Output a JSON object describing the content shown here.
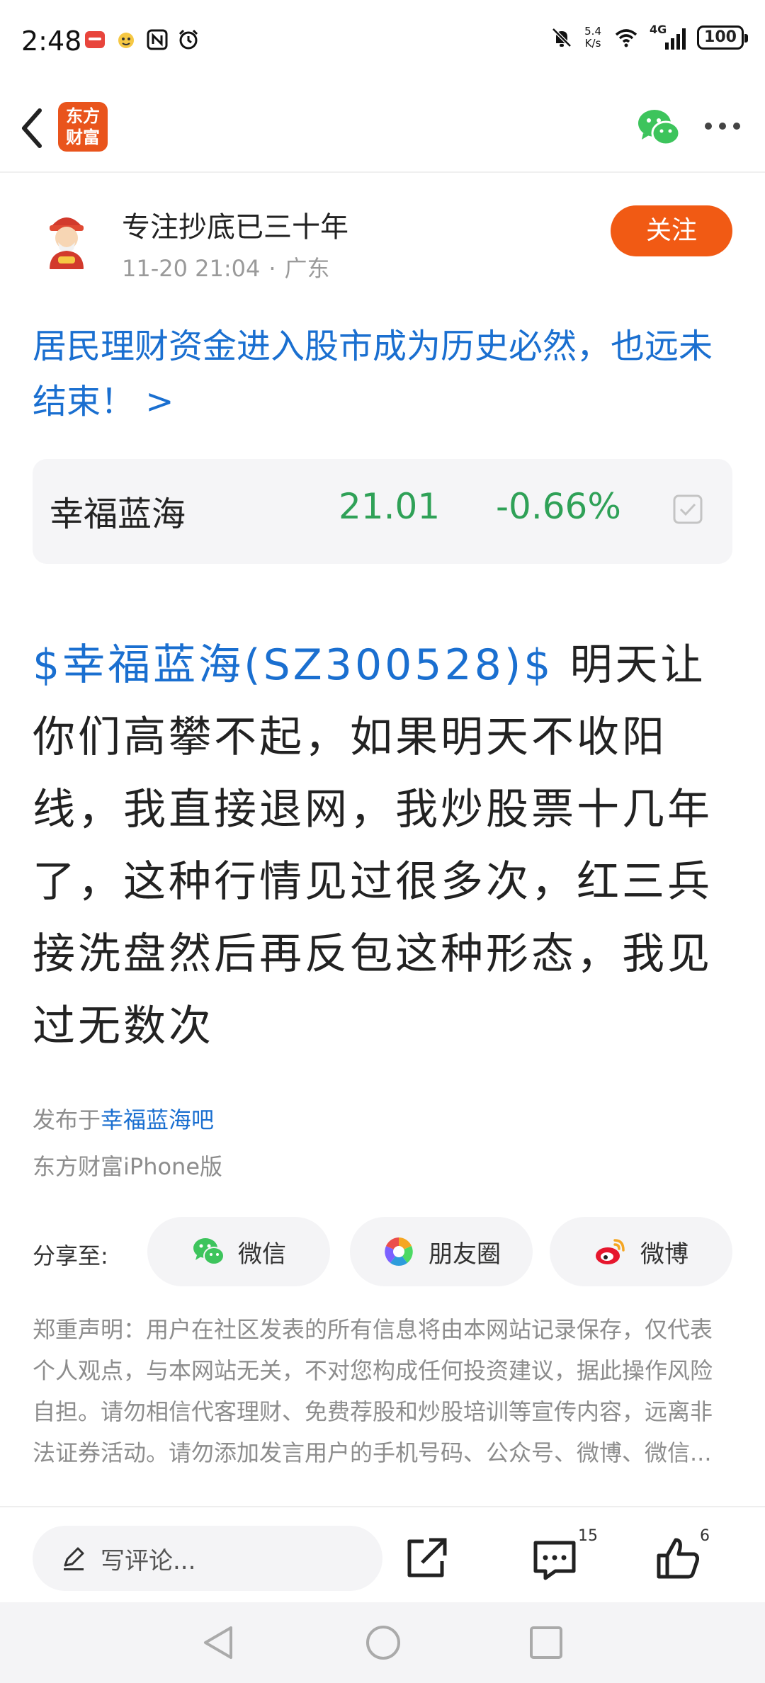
{
  "status_bar": {
    "time": "2:48",
    "net_speed_value": "5.4",
    "net_speed_unit": "K/s",
    "network": "4G",
    "battery": "100"
  },
  "nav": {
    "logo_line1": "东方",
    "logo_line2": "财富"
  },
  "author": {
    "name": "专注抄底已三十年",
    "time": "11-20 21:04",
    "separator": "·",
    "location": "广东",
    "follow_label": "关注"
  },
  "headline": {
    "text": "居民理财资金进入股市成为历史必然，也远未结束！ >"
  },
  "stock_card": {
    "name": "幸福蓝海",
    "price": "21.01",
    "change": "-0.66%",
    "color": "#2fa157"
  },
  "post": {
    "stock_link": "$幸福蓝海(SZ300528)$",
    "content": " 明天让你们高攀不起，如果明天不收阳线，我直接退网，我炒股票十几年了，这种行情见过很多次，红三兵接洗盘然后再反包这种形态，我见过无数次"
  },
  "source": {
    "published_prefix": "发布于",
    "bar_name": "幸福蓝海吧",
    "client": "东方财富iPhone版"
  },
  "share": {
    "label": "分享至:",
    "buttons": [
      {
        "label": "微信",
        "icon": "wechat-icon"
      },
      {
        "label": "朋友圈",
        "icon": "moments-icon"
      },
      {
        "label": "微博",
        "icon": "weibo-icon"
      }
    ]
  },
  "disclaimer": {
    "text": "郑重声明：用户在社区发表的所有信息将由本网站记录保存，仅代表个人观点，与本网站无关，不对您构成任何投资建议，据此操作风险自担。请勿相信代客理财、免费荐股和炒股培训等宣传内容，远离非法证券活动。请勿添加发言用户的手机号码、公众号、微博、微信..."
  },
  "bottom_bar": {
    "comment_placeholder": "写评论...",
    "comment_count": "15",
    "like_count": "6"
  },
  "colors": {
    "accent": "#f15a14",
    "link": "#1a6fd0",
    "stock_down": "#2fa157"
  }
}
